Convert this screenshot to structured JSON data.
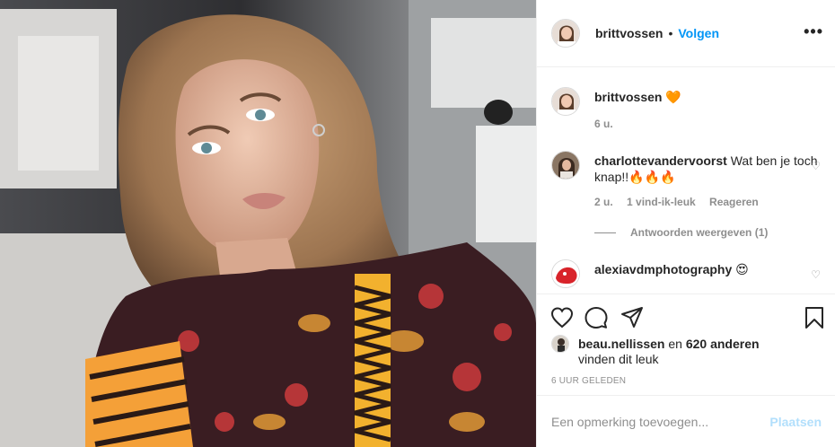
{
  "post": {
    "author": "brittvossen",
    "follow_label": "Volgen",
    "separator": "•",
    "more_label": "•••"
  },
  "caption": {
    "username": "brittvossen",
    "emoji": "🧡",
    "time": "6 u."
  },
  "comments": [
    {
      "username": "charlottevandervoorst",
      "text": "Wat ben je toch knap!!🔥🔥🔥",
      "time": "2 u.",
      "likes": "1 vind-ik-leuk",
      "reply_label": "Reageren",
      "view_replies": "Antwoorden weergeven (1)"
    },
    {
      "username": "alexiavdmphotography",
      "text": "😍"
    }
  ],
  "likes": {
    "user": "beau.nellissen",
    "connector": "en",
    "others": "620 anderen",
    "suffix": "vinden dit leuk"
  },
  "timestamp": "6 UUR GELEDEN",
  "add_comment": {
    "placeholder": "Een opmerking toevoegen...",
    "submit_label": "Plaatsen"
  },
  "icons": {
    "like": "heart-outline-icon",
    "comment": "comment-bubble-icon",
    "share": "paper-plane-icon",
    "save": "bookmark-icon",
    "more": "ellipsis-icon"
  },
  "colors": {
    "link_blue": "#0095f6",
    "post_button_disabled": "#b2dffc",
    "muted": "#8e8e8e",
    "text": "#262626",
    "divider": "#efefef"
  }
}
